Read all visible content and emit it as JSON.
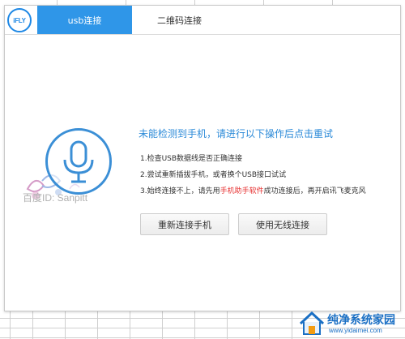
{
  "app": {
    "logo_text": "iFLY"
  },
  "tabs": [
    {
      "label": "usb连接",
      "active": true
    },
    {
      "label": "二维码连接",
      "active": false
    }
  ],
  "main": {
    "headline": "未能检测到手机，请进行以下操作后点击重试",
    "steps": [
      {
        "text": "1.检查USB数据线是否正确连接"
      },
      {
        "text": "2.尝试重新插拔手机，或者换个USB接口试试"
      },
      {
        "prefix": "3.始终连接不上，请先用",
        "highlight": "手机助手软件",
        "suffix": "成功连接后，再开启讯飞麦克风"
      }
    ],
    "buttons": {
      "reconnect": "重新连接手机",
      "wireless": "使用无线连接"
    }
  },
  "watermark": {
    "id_text": "百度ID: Sanpitt"
  },
  "site_logo": {
    "name": "纯净系统家园",
    "url": "www.yidaimei.com"
  },
  "colors": {
    "accent": "#2f96e8",
    "headline": "#2b8ad8",
    "highlight": "#e62b2b",
    "logo": "#1e88e5"
  },
  "icons": {
    "logo": "ifly-logo-icon",
    "microphone": "microphone-icon",
    "site": "house-logo-icon"
  }
}
